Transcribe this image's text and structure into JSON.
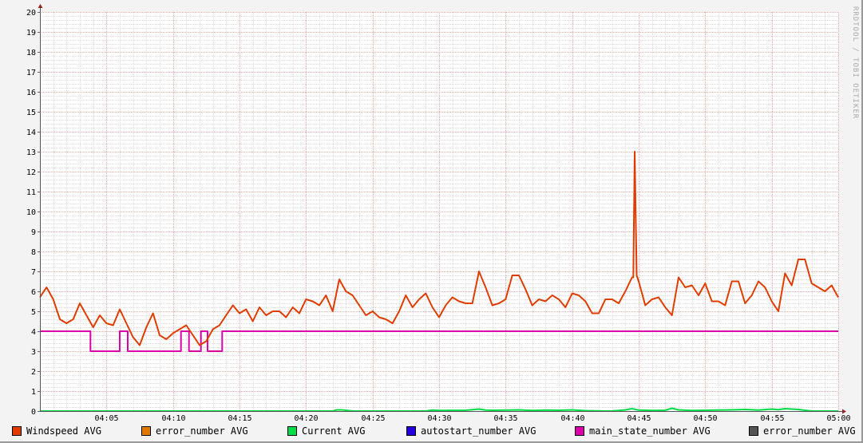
{
  "watermark": "RRDTOOL / TOBI OETIKER",
  "chart_data": {
    "type": "line",
    "title": "",
    "xlabel": "",
    "ylabel": "",
    "ylim": [
      0,
      20
    ],
    "xlim_minutes": [
      0,
      60
    ],
    "y_ticks": [
      "0",
      "1",
      "2",
      "3",
      "4",
      "5",
      "6",
      "7",
      "8",
      "9",
      "10",
      "11",
      "12",
      "13",
      "14",
      "15",
      "16",
      "17",
      "18",
      "19",
      "20"
    ],
    "x_ticks": [
      {
        "m": 5,
        "label": "04:05"
      },
      {
        "m": 10,
        "label": "04:10"
      },
      {
        "m": 15,
        "label": "04:15"
      },
      {
        "m": 20,
        "label": "04:20"
      },
      {
        "m": 25,
        "label": "04:25"
      },
      {
        "m": 30,
        "label": "04:30"
      },
      {
        "m": 35,
        "label": "04:35"
      },
      {
        "m": 40,
        "label": "04:40"
      },
      {
        "m": 45,
        "label": "04:45"
      },
      {
        "m": 50,
        "label": "04:50"
      },
      {
        "m": 55,
        "label": "04:55"
      },
      {
        "m": 60,
        "label": "05:00"
      }
    ],
    "grid": true,
    "legend_position": "bottom",
    "series": [
      {
        "name": "Windspeed AVG",
        "color": "#e03c00",
        "x": [
          0,
          0.5,
          1,
          1.5,
          2,
          2.5,
          3,
          3.5,
          4,
          4.5,
          5,
          5.5,
          6,
          6.5,
          7,
          7.5,
          8,
          8.5,
          9,
          9.5,
          10,
          10.5,
          11,
          11.5,
          12,
          12.5,
          13,
          13.5,
          14,
          14.5,
          15,
          15.5,
          16,
          16.5,
          17,
          17.5,
          18,
          18.5,
          19,
          19.5,
          20,
          20.5,
          21,
          21.5,
          22,
          22.5,
          23,
          23.5,
          24,
          24.5,
          25,
          25.5,
          26,
          26.5,
          27,
          27.5,
          28,
          28.5,
          29,
          29.5,
          30,
          30.5,
          31,
          31.5,
          32,
          32.5,
          33,
          33.5,
          34,
          34.5,
          35,
          35.5,
          36,
          36.5,
          37,
          37.5,
          38,
          38.5,
          39,
          39.5,
          40,
          40.5,
          41,
          41.5,
          42,
          42.5,
          43,
          43.5,
          44,
          44.5,
          44.6,
          44.7,
          44.85,
          45,
          45.5,
          46,
          46.5,
          47,
          47.5,
          48,
          48.5,
          49,
          49.5,
          50,
          50.5,
          51,
          51.5,
          52,
          52.5,
          53,
          53.5,
          54,
          54.5,
          55,
          55.5,
          56,
          56.5,
          57,
          57.5,
          58,
          58.5,
          59,
          59.5,
          60
        ],
        "values": [
          5.7,
          6.2,
          5.6,
          4.6,
          4.4,
          4.6,
          5.4,
          4.8,
          4.2,
          4.8,
          4.4,
          4.3,
          5.1,
          4.4,
          3.7,
          3.3,
          4.2,
          4.9,
          3.8,
          3.6,
          3.9,
          4.1,
          4.3,
          3.8,
          3.3,
          3.5,
          4.1,
          4.3,
          4.8,
          5.3,
          4.9,
          5.1,
          4.5,
          5.2,
          4.8,
          5.0,
          5.0,
          4.7,
          5.2,
          4.9,
          5.6,
          5.5,
          5.3,
          5.8,
          5.0,
          6.6,
          6.0,
          5.8,
          5.3,
          4.8,
          5.0,
          4.7,
          4.6,
          4.4,
          5.0,
          5.8,
          5.2,
          5.6,
          5.9,
          5.2,
          4.7,
          5.3,
          5.7,
          5.5,
          5.4,
          5.4,
          7.0,
          6.2,
          5.3,
          5.4,
          5.6,
          6.8,
          6.8,
          6.1,
          5.3,
          5.6,
          5.5,
          5.8,
          5.6,
          5.2,
          5.9,
          5.8,
          5.5,
          4.9,
          4.9,
          5.6,
          5.6,
          5.4,
          6.0,
          6.7,
          6.7,
          13.0,
          6.8,
          6.5,
          5.3,
          5.6,
          5.7,
          5.2,
          4.8,
          6.7,
          6.2,
          6.3,
          5.8,
          6.4,
          5.5,
          5.5,
          5.3,
          6.5,
          6.5,
          5.4,
          5.8,
          6.5,
          6.2,
          5.5,
          5.0,
          6.9,
          6.3,
          7.6,
          7.6,
          6.4,
          6.2,
          6.0,
          6.3,
          5.7
        ]
      },
      {
        "name": "error_number AVG",
        "color": "#e07800",
        "x": [],
        "values": []
      },
      {
        "name": "Current AVG",
        "color": "#00dd44",
        "x": [
          0,
          22,
          22.3,
          22.7,
          23,
          23.5,
          29,
          29.5,
          30,
          32,
          33,
          33.5,
          34,
          36,
          37,
          38,
          39,
          40,
          41,
          43,
          44,
          44.5,
          45,
          46,
          47,
          47.5,
          48,
          49,
          50,
          52,
          53,
          54,
          55,
          55.5,
          56,
          57,
          57.5,
          58,
          60
        ],
        "values": [
          0,
          0,
          0.06,
          0.06,
          0.04,
          0,
          0,
          0.05,
          0.03,
          0.04,
          0.1,
          0.05,
          0.04,
          0.06,
          0.03,
          0.05,
          0.04,
          0.06,
          0.02,
          0,
          0.06,
          0.12,
          0.05,
          0.03,
          0.04,
          0.14,
          0.06,
          0.03,
          0.04,
          0.06,
          0.08,
          0.05,
          0.1,
          0.07,
          0.12,
          0.08,
          0.04,
          0,
          0
        ]
      },
      {
        "name": "autostart_number AVG",
        "color": "#2200dd",
        "x": [],
        "values": []
      },
      {
        "name": "main_state_number AVG",
        "color": "#dd00aa",
        "x": [
          0,
          3.8,
          3.8,
          6,
          6,
          6.6,
          6.6,
          10.6,
          10.6,
          11.2,
          11.2,
          12.1,
          12.1,
          12.6,
          12.6,
          13.7,
          13.7,
          60
        ],
        "values": [
          4,
          4,
          3,
          3,
          4,
          4,
          3,
          3,
          4,
          4,
          3,
          3,
          4,
          4,
          3,
          3,
          4,
          4
        ]
      },
      {
        "name": "error_number AVG",
        "color": "#555555",
        "x": [],
        "values": []
      }
    ]
  }
}
